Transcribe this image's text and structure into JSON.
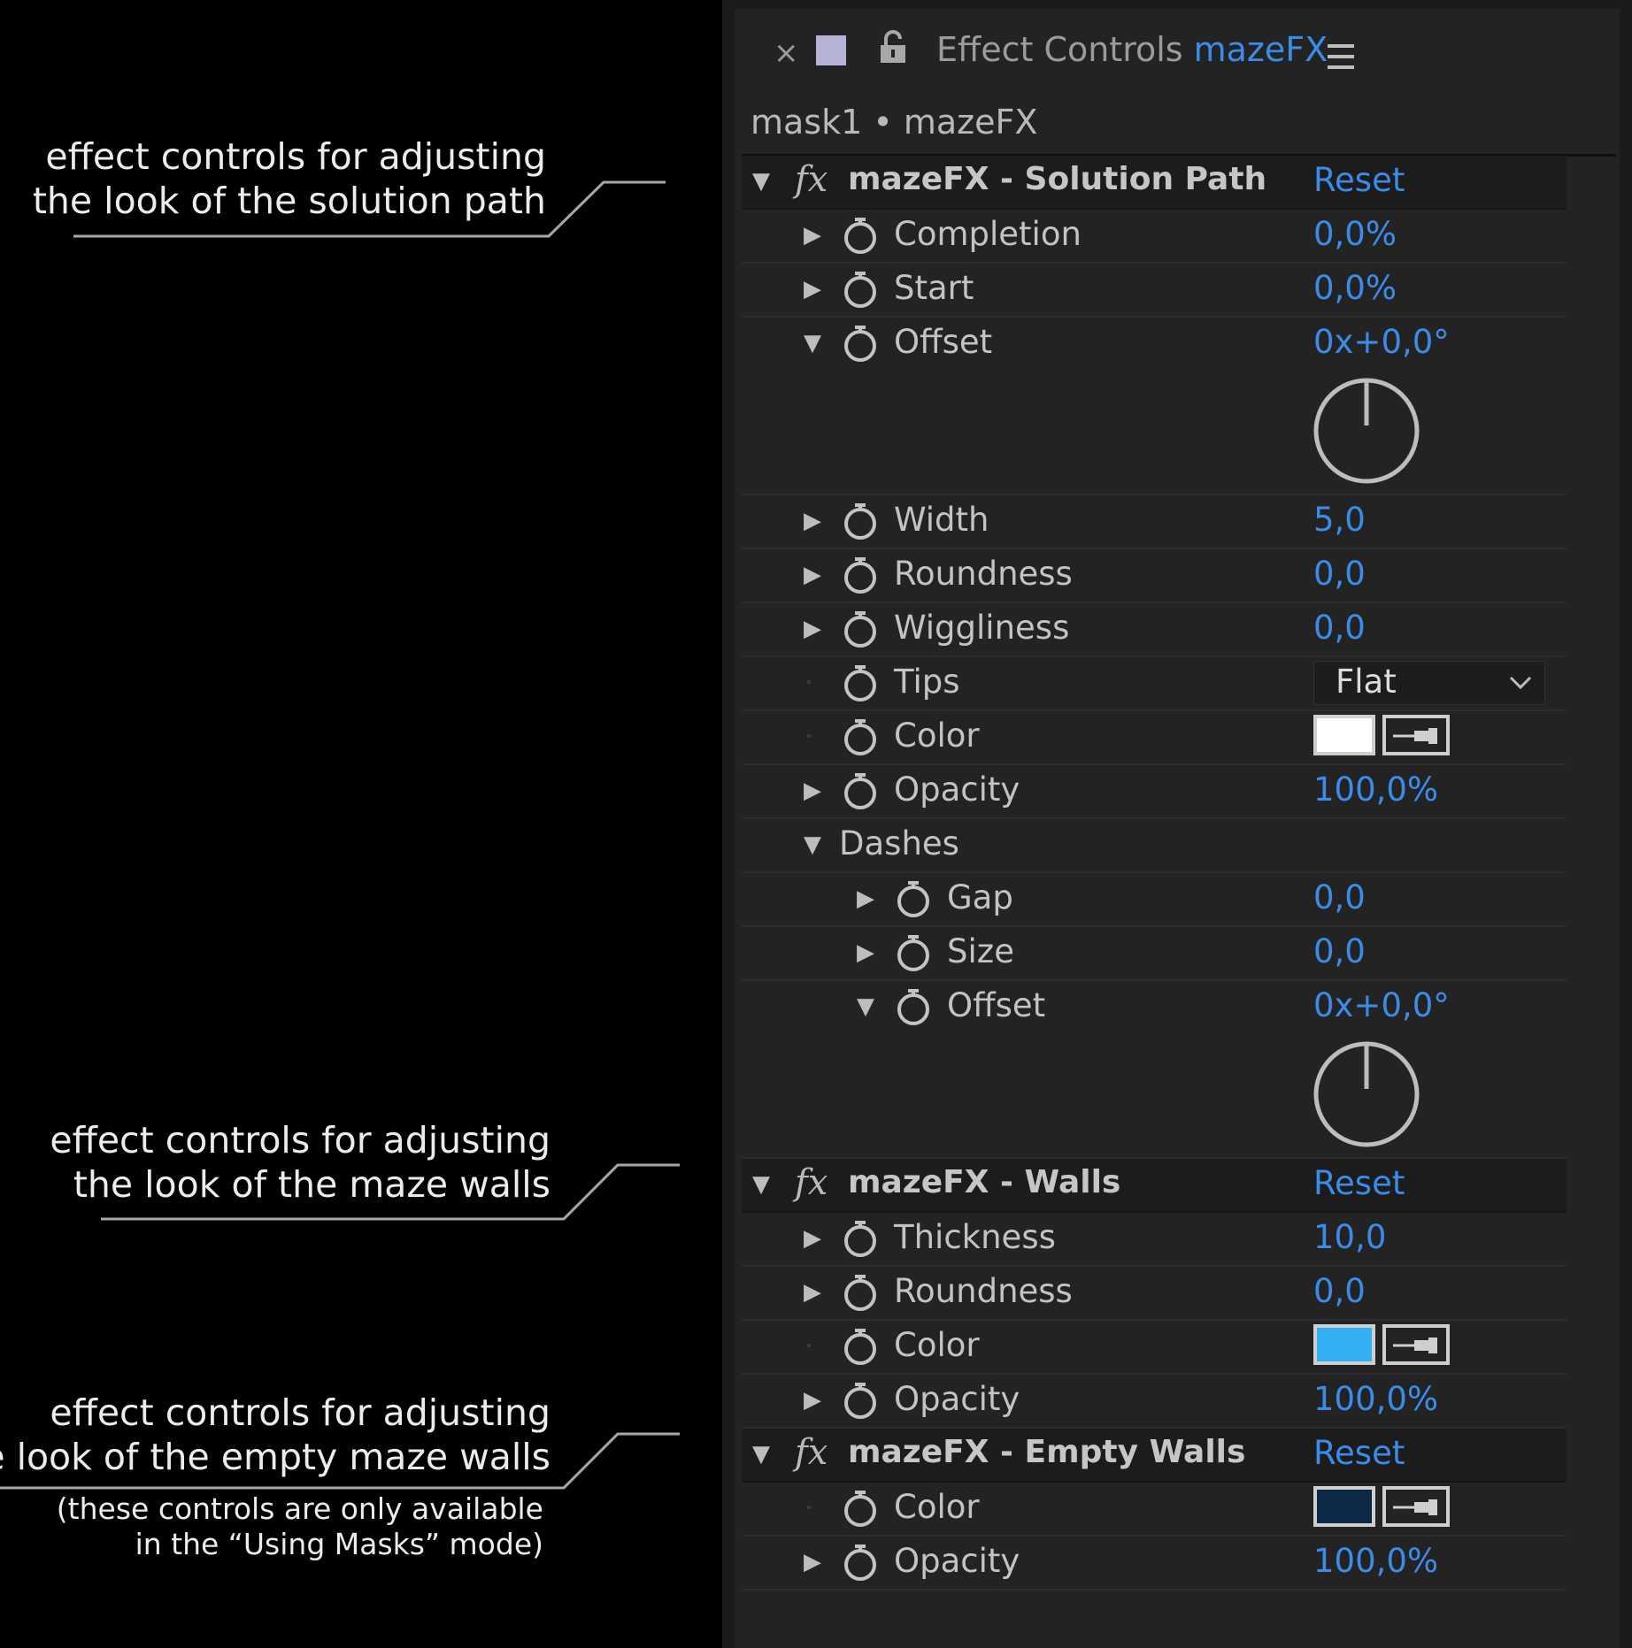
{
  "annotations": {
    "solution": {
      "line1": "effect controls for adjusting",
      "line2": "the look of the solution path"
    },
    "walls": {
      "line1": "effect controls for adjusting",
      "line2": "the look of the maze walls"
    },
    "empty": {
      "line1": "effect controls for adjusting",
      "line2": "the look of the empty maze walls",
      "note1": "(these controls are only available",
      "note2": "in the “Using Masks” mode)"
    }
  },
  "panel": {
    "close": "×",
    "title": "Effect Controls",
    "title_name": "mazeFX",
    "breadcrumb": "mask1 • mazeFX"
  },
  "solution": {
    "title": "mazeFX - Solution Path",
    "reset": "Reset",
    "completion": {
      "label": "Completion",
      "value": "0,0%"
    },
    "start": {
      "label": "Start",
      "value": "0,0%"
    },
    "offset": {
      "label": "Offset",
      "value": "0x+0,0°"
    },
    "width": {
      "label": "Width",
      "value": "5,0"
    },
    "roundness": {
      "label": "Roundness",
      "value": "0,0"
    },
    "wiggliness": {
      "label": "Wiggliness",
      "value": "0,0"
    },
    "tips": {
      "label": "Tips",
      "value": "Flat"
    },
    "color": {
      "label": "Color",
      "swatch": "#ffffff"
    },
    "opacity": {
      "label": "Opacity",
      "value": "100,0%"
    },
    "dashes": {
      "label": "Dashes",
      "gap": {
        "label": "Gap",
        "value": "0,0"
      },
      "size": {
        "label": "Size",
        "value": "0,0"
      },
      "offset": {
        "label": "Offset",
        "value": "0x+0,0°"
      }
    }
  },
  "walls": {
    "title": "mazeFX - Walls",
    "reset": "Reset",
    "thickness": {
      "label": "Thickness",
      "value": "10,0"
    },
    "roundness": {
      "label": "Roundness",
      "value": "0,0"
    },
    "color": {
      "label": "Color",
      "swatch": "#33b0f5"
    },
    "opacity": {
      "label": "Opacity",
      "value": "100,0%"
    }
  },
  "empty_walls": {
    "title": "mazeFX - Empty Walls",
    "reset": "Reset",
    "color": {
      "label": "Color",
      "swatch": "#0c2a45"
    },
    "opacity": {
      "label": "Opacity",
      "value": "100,0%"
    }
  }
}
